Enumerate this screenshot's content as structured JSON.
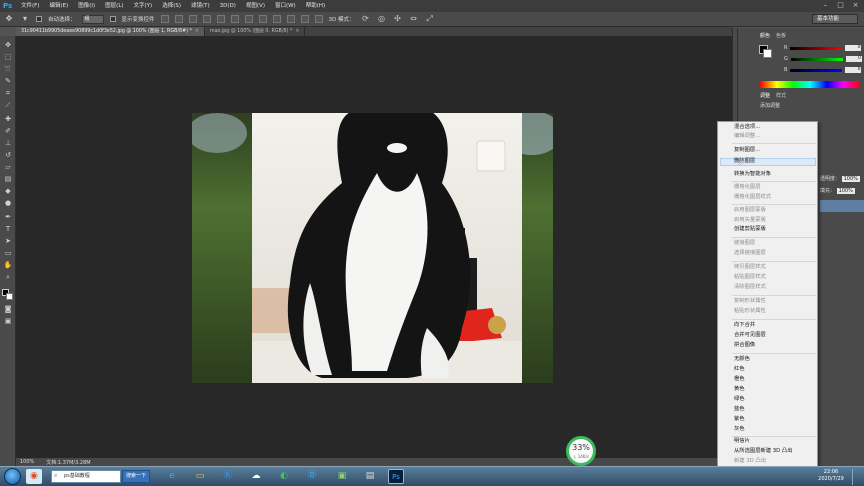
{
  "app": {
    "logo": "Ps"
  },
  "menubar": {
    "items": [
      "文件(F)",
      "编辑(E)",
      "图像(I)",
      "图层(L)",
      "文字(Y)",
      "选择(S)",
      "滤镜(T)",
      "3D(D)",
      "视图(V)",
      "窗口(W)",
      "帮助(H)"
    ],
    "window_controls": [
      "–",
      "□",
      "×"
    ]
  },
  "options_bar": {
    "auto_select_label": "自动选择：",
    "auto_select_value": "组",
    "show_transform_label": "显示变换控件",
    "mode_3d_label": "3D 模式：",
    "workspace": "基本功能"
  },
  "tabs": [
    {
      "label": "31c90411b9905deaee90899c1d0f3e52.jpg @ 100% (图层 1, RGB/8#) *",
      "close": "×"
    },
    {
      "label": "mao.jpg @ 100% (图层 0, RGB/8) *",
      "close": "×"
    }
  ],
  "status_bar": {
    "zoom": "100%",
    "doc_info": "文档:1.37M/3.28M"
  },
  "panels": {
    "color_tabs": [
      "颜色",
      "色板"
    ],
    "r_label": "R",
    "g_label": "G",
    "b_label": "B",
    "r_value": "0",
    "g_value": "0",
    "b_value": "0",
    "adjust_tabs": [
      "调整",
      "样式"
    ],
    "add_adjustment": "添加调整",
    "opacity_label": "透明度：",
    "opacity_value": "100%",
    "fill_label": "填充：",
    "fill_value": "100%"
  },
  "context_menu": {
    "items": [
      {
        "label": "混合选项...",
        "enabled": true
      },
      {
        "label": "编辑调整...",
        "enabled": false
      },
      {
        "label": "复制图层...",
        "enabled": true
      },
      {
        "label": "删除图层",
        "enabled": true,
        "highlighted": true
      },
      {
        "label": "转换为智能对象",
        "enabled": true
      },
      {
        "label": "栅格化图层",
        "enabled": false
      },
      {
        "label": "栅格化图层样式",
        "enabled": false
      },
      {
        "label": "启用图层蒙版",
        "enabled": false
      },
      {
        "label": "启用矢量蒙版",
        "enabled": false
      },
      {
        "label": "创建剪贴蒙版",
        "enabled": true
      },
      {
        "label": "链接图层",
        "enabled": false
      },
      {
        "label": "选择链接图层",
        "enabled": false
      },
      {
        "label": "拷贝图层样式",
        "enabled": false
      },
      {
        "label": "粘贴图层样式",
        "enabled": false
      },
      {
        "label": "清除图层样式",
        "enabled": false
      },
      {
        "label": "复制形状属性",
        "enabled": false
      },
      {
        "label": "粘贴形状属性",
        "enabled": false
      },
      {
        "label": "向下合并",
        "enabled": true
      },
      {
        "label": "合并可见图层",
        "enabled": true
      },
      {
        "label": "拼合图像",
        "enabled": true
      },
      {
        "label": "无颜色",
        "enabled": true
      },
      {
        "label": "红色",
        "enabled": true
      },
      {
        "label": "橙色",
        "enabled": true
      },
      {
        "label": "黄色",
        "enabled": true
      },
      {
        "label": "绿色",
        "enabled": true
      },
      {
        "label": "蓝色",
        "enabled": true
      },
      {
        "label": "紫色",
        "enabled": true
      },
      {
        "label": "灰色",
        "enabled": true
      },
      {
        "label": "明信片",
        "enabled": true
      },
      {
        "label": "从所选图层新建 3D 凸出",
        "enabled": true
      },
      {
        "label": "新建 3D 凸出",
        "enabled": false
      }
    ]
  },
  "net_widget": {
    "percent": "33%",
    "speed": "↓ 14K/s"
  },
  "taskbar": {
    "search_text": "ps基础教程",
    "search_button": "搜索一下",
    "time": "22:06",
    "date": "2020/7/29"
  },
  "colors": {
    "accent": "#31a8ff",
    "menu_highlight": "#dbe9f8",
    "widget_ring": "#3cbb5e"
  }
}
